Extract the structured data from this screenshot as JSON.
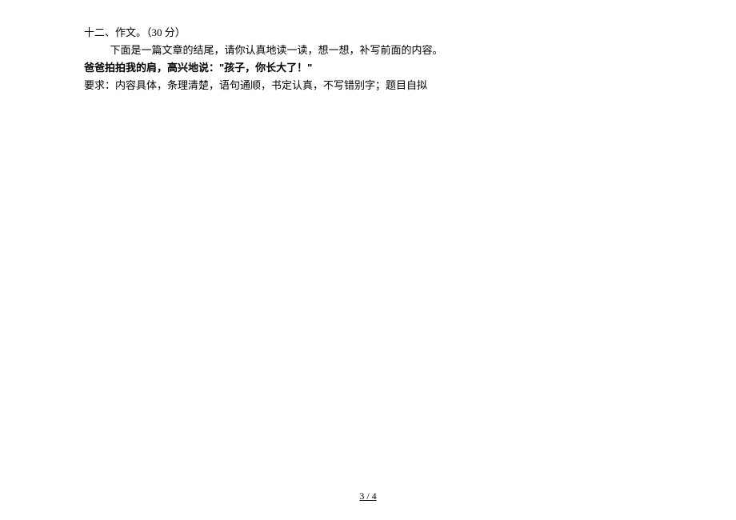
{
  "heading": "十二、作文。（30 分）",
  "instruction": "下面是一篇文章的结尾，请你认真地读一读，想一想，补写前面的内容。",
  "bold_line": "爸爸拍拍我的肩，高兴地说：\"孩子，你长大了！\"",
  "requirement": "要求：内容具体，条理清楚，语句通顺，书定认真，不写错别字；题目自拟",
  "footer_page": "3 / 4"
}
